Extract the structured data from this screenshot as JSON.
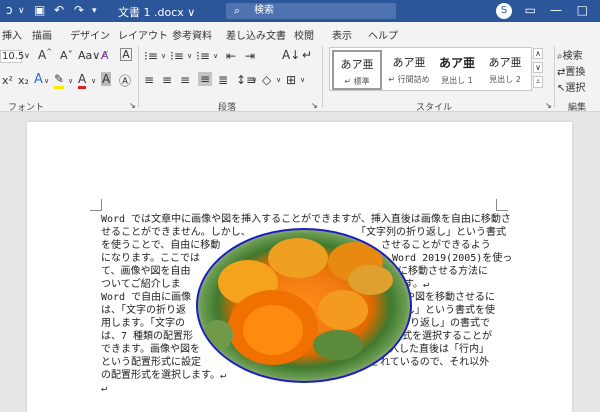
{
  "titlebar": {
    "doc_title": "文書 1 .docx ∨",
    "search_placeholder": "検索",
    "user_initial": "S"
  },
  "tabs": [
    "挿入",
    "描画",
    "デザイン",
    "レイアウト",
    "参考資料",
    "差し込み文書",
    "校閲",
    "表示",
    "ヘルプ"
  ],
  "ribbon": {
    "font_size": "10.5",
    "font_group_label": "フォント",
    "paragraph_group_label": "段落",
    "styles_group_label": "スタイル",
    "edit_group_label": "編集",
    "styles": [
      {
        "sample": "あア亜",
        "name": "↵ 標準"
      },
      {
        "sample": "あア亜",
        "name": "↵ 行間詰め"
      },
      {
        "sample": "あア亜",
        "name": "見出し 1"
      },
      {
        "sample": "あア亜",
        "name": "見出し 2"
      }
    ],
    "edit": {
      "find": "検索",
      "replace": "置換",
      "select": "選択"
    }
  },
  "document": {
    "lines": [
      "Word では文章中に画像や図を挿入することができますが、挿入直後は画像を自由に移動さ",
      "せることができません。しかし、",
      "「文字列の折り返し」という書式",
      "を使うことで、自由に移動",
      "させることができるよう",
      "になります。ここでは",
      "Word 2019(2005)を使っ",
      "て、画像や図を自由",
      "に移動させる方法に",
      "ついてご紹介しま",
      "す。↵",
      "Word で自由に画像",
      "や図を移動させるに",
      "は、「文字の折り返",
      "し」という書式を使",
      "用します。「文字の",
      "折り返し」の書式で",
      "は、7 種類の配置形",
      "式を選択することが",
      "できます。画像や図を",
      "挿入した直後は「行内」",
      "という配置形式に設定",
      "されているので、それ以外",
      "の配置形式を選択します。↵",
      "↵"
    ]
  }
}
